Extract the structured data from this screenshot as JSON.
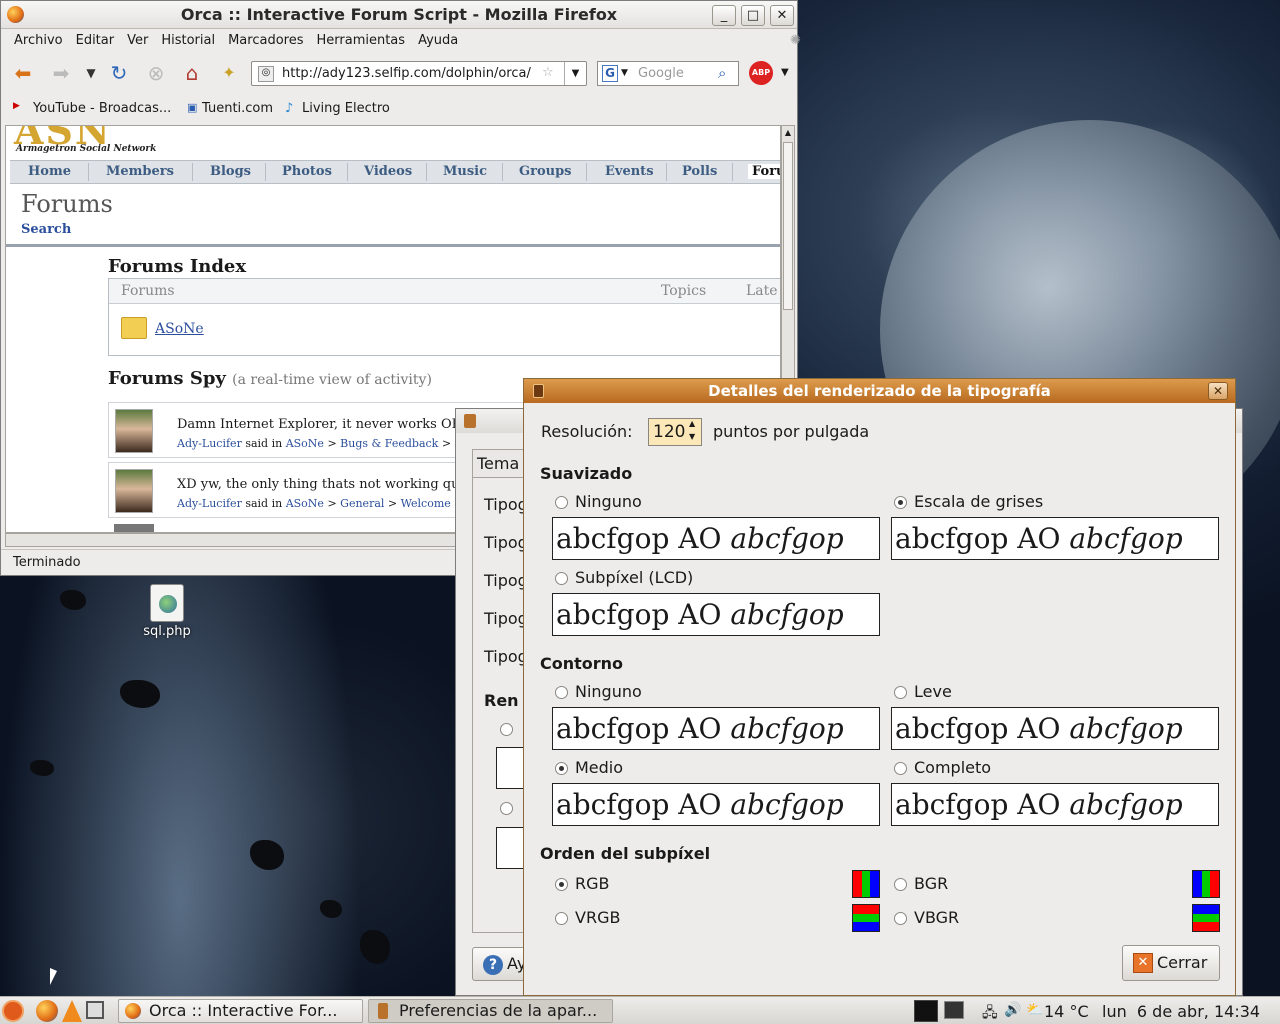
{
  "desktop": {
    "icon_label": "sql.php"
  },
  "firefox": {
    "title": "Orca :: Interactive Forum Script - Mozilla Firefox",
    "menu": [
      "Archivo",
      "Editar",
      "Ver",
      "Historial",
      "Marcadores",
      "Herramientas",
      "Ayuda"
    ],
    "url": "http://ady123.selfip.com/dolphin/orca/",
    "search_placeholder": "Google",
    "bookmarks": [
      "YouTube - Broadcas...",
      "Tuenti.com",
      "Living Electro"
    ],
    "status": "Terminado",
    "page": {
      "logo_sub": "Armagetron Social Network",
      "tabs": [
        "Home",
        "Members",
        "Blogs",
        "Photos",
        "Videos",
        "Music",
        "Groups",
        "Events",
        "Polls",
        "Foru"
      ],
      "section_title": "Forums",
      "search_link": "Search",
      "index_title": "Forums Index",
      "col_forums": "Forums",
      "col_topics": "Topics",
      "col_latest": "Late",
      "forum_name": "ASoNe",
      "spy_title": "Forums Spy",
      "spy_sub": "(a real-time view of activity)",
      "posts": [
        {
          "text": "Damn Internet Explorer, it never works OK",
          "user": "Ady-Lucifer",
          "said_in": "said in",
          "forum": "ASoNe",
          "topic": "Bugs & Feedback"
        },
        {
          "text": "XD yw, the only thing thats not working qu",
          "user": "Ady-Lucifer",
          "said_in": "said in",
          "forum": "ASoNe",
          "topic": "General",
          "sub": "Welcome"
        }
      ]
    }
  },
  "back_dialog": {
    "tab": "Tema",
    "rows": [
      "Tipog",
      "Tipog",
      "Tipog",
      "Tipog",
      "Tipog"
    ],
    "render_label": "Ren",
    "help_button": "Ay"
  },
  "dialog": {
    "title": "Detalles del renderizado de la tipografía",
    "resolution_label": "Resolución:",
    "resolution_value": "120",
    "resolution_unit": "puntos por pulgada",
    "smoothing_title": "Suavizado",
    "smoothing": [
      {
        "label": "Ninguno",
        "selected": false
      },
      {
        "label": "Escala de grises",
        "selected": true
      },
      {
        "label": "Subpíxel (LCD)",
        "selected": false
      }
    ],
    "sample_text": "abcfgop AO ",
    "sample_italic": "abcfgop",
    "hinting_title": "Contorno",
    "hinting": [
      {
        "label": "Ninguno",
        "selected": false
      },
      {
        "label": "Leve",
        "selected": false
      },
      {
        "label": "Medio",
        "selected": true
      },
      {
        "label": "Completo",
        "selected": false
      }
    ],
    "subpixel_title": "Orden del subpíxel",
    "subpixel": [
      {
        "label": "RGB",
        "selected": true
      },
      {
        "label": "BGR",
        "selected": false
      },
      {
        "label": "VRGB",
        "selected": false
      },
      {
        "label": "VBGR",
        "selected": false
      }
    ],
    "close_button": "Cerrar"
  },
  "taskbar": {
    "tasks": [
      "Orca :: Interactive For...",
      "Preferencias de la apar..."
    ],
    "temperature": "14 °C",
    "clock": "lun  6 de abr, 14:34"
  },
  "colors": {
    "dialog_title": "#c27a2c",
    "link": "#2b4f9c",
    "tab_text": "#3d5c82"
  }
}
